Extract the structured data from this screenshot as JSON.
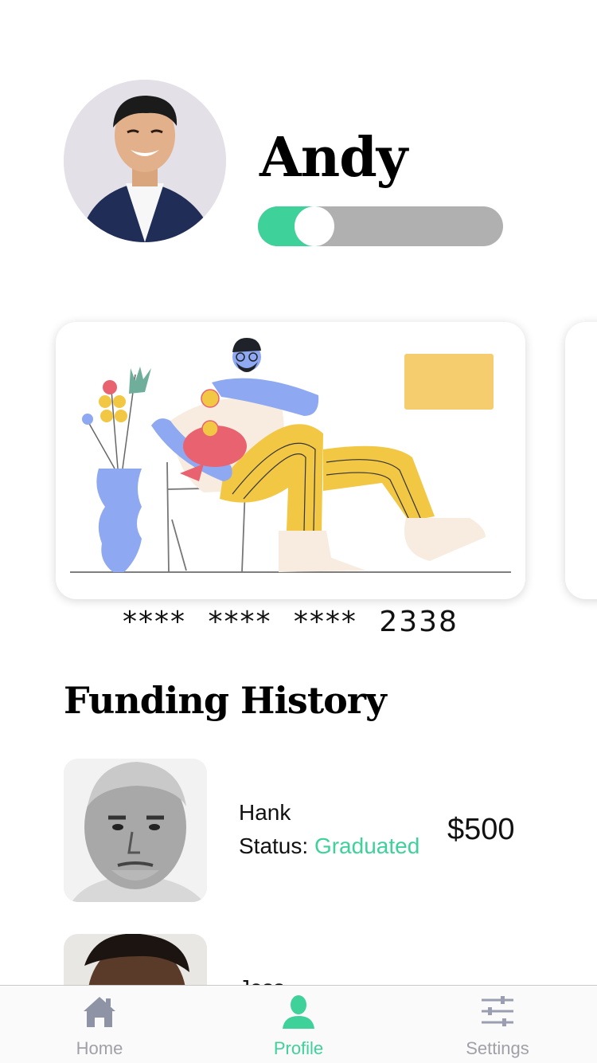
{
  "profile": {
    "name": "Andy",
    "toggle_on": true
  },
  "card": {
    "number": "**** **** **** 2338"
  },
  "funding_history": {
    "title": "Funding History",
    "status_label": "Status:",
    "items": [
      {
        "name": "Hank",
        "status": "Graduated",
        "amount": "$500"
      },
      {
        "name": "Jess",
        "status": "",
        "amount": ""
      }
    ]
  },
  "tab_bar": {
    "tabs": [
      {
        "label": "Home",
        "icon": "home-icon",
        "active": false
      },
      {
        "label": "Profile",
        "icon": "profile-icon",
        "active": true
      },
      {
        "label": "Settings",
        "icon": "sliders-icon",
        "active": false
      }
    ]
  },
  "colors": {
    "accent": "#3fd19a",
    "toggle_track": "#b0b0b0",
    "card_chip": "#f5cd6e",
    "tab_inactive": "#a0a0a8"
  }
}
